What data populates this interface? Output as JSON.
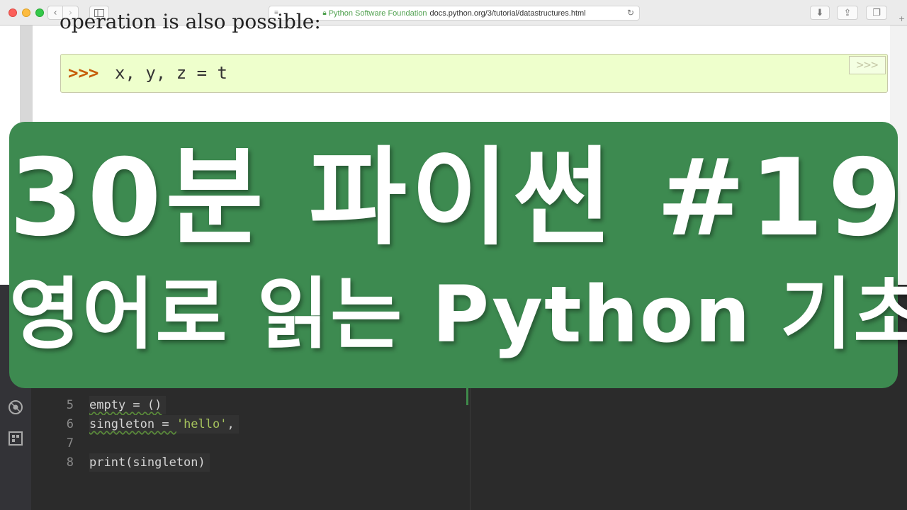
{
  "browser": {
    "address": {
      "org": "Python Software Foundation",
      "url": "docs.python.org/3/tutorial/datastructures.html"
    },
    "icons": {
      "back": "‹",
      "forward": "›",
      "reader": "≡",
      "reload": "↻",
      "download": "⬇",
      "share": "⇪",
      "tabs": "❐",
      "new_tab": "+"
    }
  },
  "doc": {
    "partial_text": "operation is also possible:",
    "code_block": {
      "prompt": ">>>",
      "code": "x, y, z = t",
      "copy_button": ">>>"
    }
  },
  "editor": {
    "lines": [
      {
        "num": "5",
        "text": "empty = ()"
      },
      {
        "num": "6",
        "text_pre": "singleton = ",
        "string": "'hello'",
        "text_post": ","
      },
      {
        "num": "7",
        "text": ""
      },
      {
        "num": "8",
        "text": "print(singleton)"
      }
    ]
  },
  "banner": {
    "title": "30분 파이썬 #19",
    "subtitle": "영어로 읽는 Python 기초",
    "color": "#3d8a50"
  }
}
